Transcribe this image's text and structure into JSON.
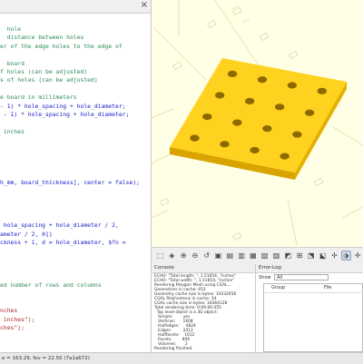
{
  "editor": {
    "title_close": "×",
    "lines": [
      {
        "text": "  hole",
        "kind": "comment"
      },
      {
        "text": "  distance between holes",
        "kind": "comment"
      },
      {
        "text": "er of the edge holes to the edge of",
        "kind": "comment"
      },
      {
        "text": "",
        "kind": "code"
      },
      {
        "text": "  board",
        "kind": "comment"
      },
      {
        "text": "f holes (can be adjusted)",
        "kind": "comment"
      },
      {
        "text": "s of holes (can be adjusted)",
        "kind": "comment"
      },
      {
        "text": "",
        "kind": "code"
      },
      {
        "text": "e board in millimeters",
        "kind": "comment"
      },
      {
        "text": "- 1) * hole_spacing + hole_diameter;",
        "kind": "code"
      },
      {
        "text": " - 1) * hole_spacing + hole_diameter;",
        "kind": "code"
      },
      {
        "text": "",
        "kind": "code"
      },
      {
        "text": " inches",
        "kind": "comment"
      },
      {
        "text": "",
        "kind": "code"
      },
      {
        "text": "",
        "kind": "code"
      },
      {
        "text": "",
        "kind": "code"
      },
      {
        "text": "",
        "kind": "code"
      },
      {
        "text": "",
        "kind": "code"
      },
      {
        "text": "h_mm, board_thickness], center = false);",
        "kind": "code"
      },
      {
        "text": "",
        "kind": "code"
      },
      {
        "text": "",
        "kind": "code"
      },
      {
        "text": "",
        "kind": "code"
      },
      {
        "text": "",
        "kind": "code"
      },
      {
        "text": " hole_spacing + hole_diameter / 2,",
        "kind": "code"
      },
      {
        "text": "ameter / 2, 0])",
        "kind": "code"
      },
      {
        "text": "ckness + 1, d = hole_diameter, $fn =",
        "kind": "code"
      },
      {
        "text": "",
        "kind": "code"
      },
      {
        "text": "",
        "kind": "code"
      },
      {
        "text": "",
        "kind": "code"
      },
      {
        "text": "",
        "kind": "code"
      },
      {
        "text": "ed number of rows and columns",
        "kind": "comment"
      },
      {
        "text": "",
        "kind": "code"
      },
      {
        "text": "",
        "kind": "code"
      },
      {
        "text": "nches",
        "kind": "string"
      },
      {
        "text": " inches\");",
        "kind": "string"
      },
      {
        "text": "ches\");",
        "kind": "string"
      }
    ]
  },
  "statusbar": {
    "text": "e = 163.29, fov = 22.50 (7a1a672)"
  },
  "toolbar": {
    "buttons": [
      {
        "name": "view-all-button",
        "glyph": "⬚"
      },
      {
        "name": "view-3d-button",
        "glyph": "◈"
      },
      {
        "name": "zoom-in-button",
        "glyph": "⊕"
      },
      {
        "name": "zoom-out-button",
        "glyph": "⊖"
      },
      {
        "name": "reset-view-button",
        "glyph": "↺"
      },
      {
        "name": "view-right-button",
        "glyph": "▣"
      },
      {
        "name": "view-top-button",
        "glyph": "▤"
      },
      {
        "name": "view-bottom-button",
        "glyph": "▥"
      },
      {
        "name": "view-left-button",
        "glyph": "▦"
      },
      {
        "name": "view-front-button",
        "glyph": "▧"
      },
      {
        "name": "view-back-button",
        "glyph": "▨"
      },
      {
        "name": "diagonal-view-button",
        "glyph": "◩"
      },
      {
        "name": "center-view-button",
        "glyph": "⊞"
      },
      {
        "name": "perspective-button",
        "glyph": "⬔"
      },
      {
        "name": "orthogonal-button",
        "glyph": "⬕"
      },
      {
        "name": "show-axes-button",
        "glyph": "✢"
      },
      {
        "name": "show-edges-button",
        "glyph": "⬗"
      },
      {
        "name": "show-crosshairs-button",
        "glyph": "✛"
      }
    ]
  },
  "console": {
    "title": "Console",
    "lines": [
      "ECHO: \"Total length: \", 1.51654, \"inches\"",
      "ECHO: \"Total width: \", 1.51654, \"inches\"",
      "Rendering Polygon Mesh using CGAL...",
      "Geometries in cache: 453",
      "Geometry cache size in bytes: 10332456",
      "CGAL Polyhedrons in cache: 34",
      "CGAL cache size in bytes: 16464128",
      "Total rendering time: 0:00:00.055",
      "  Top level object is a 3D object:",
      "   Simple:        yes",
      "   Vertices:      1608",
      "   Halfedges:     4824",
      "   Edges:         2412",
      "   Halffacets:    1612",
      "   Facets:        806",
      "   Volumes:       2",
      "Rendering finished."
    ]
  },
  "errorlog": {
    "title": "Error-Log",
    "show_label": "Show",
    "show_value": "All",
    "columns": [
      "Group",
      "File"
    ]
  }
}
